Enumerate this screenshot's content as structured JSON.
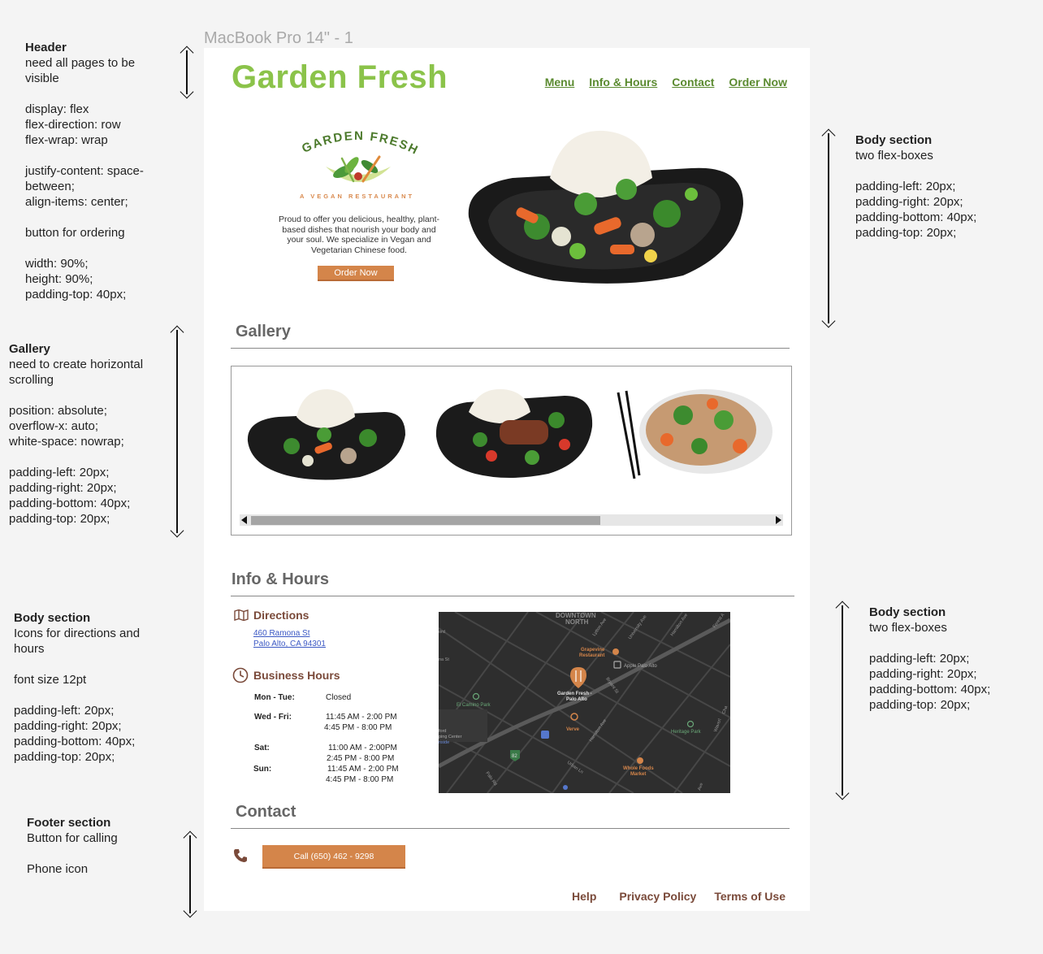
{
  "frame_label": "MacBook Pro 14\" - 1",
  "annotations": {
    "header": {
      "title": "Header",
      "lines": [
        "need all pages to be",
        "visible",
        "",
        "display: flex",
        "flex-direction: row",
        "flex-wrap: wrap",
        "",
        "justify-content: space-",
        "between;",
        "align-items: center;",
        "",
        "button for ordering",
        "",
        "width: 90%;",
        "height: 90%;",
        "padding-top: 40px;"
      ]
    },
    "gallery": {
      "title": "Gallery",
      "lines": [
        "need to create horizontal",
        "scrolling",
        "",
        "position: absolute;",
        "overflow-x: auto;",
        "white-space: nowrap;",
        "",
        "padding-left: 20px;",
        "padding-right: 20px;",
        "padding-bottom: 40px;",
        "padding-top: 20px;"
      ]
    },
    "body_info": {
      "title": "Body section",
      "lines": [
        "Icons for directions and",
        "hours",
        "",
        "font size 12pt",
        "",
        "padding-left: 20px;",
        "padding-right: 20px;",
        "padding-bottom: 40px;",
        "padding-top: 20px;"
      ]
    },
    "footer": {
      "title": "Footer section",
      "lines": [
        "Button for calling",
        "",
        "Phone icon"
      ]
    },
    "body_top_right": {
      "title": "Body section",
      "lines": [
        "two flex-boxes",
        "",
        "padding-left: 20px;",
        "padding-right: 20px;",
        "padding-bottom: 40px;",
        "padding-top: 20px;"
      ]
    },
    "body_bottom_right": {
      "title": "Body section",
      "lines": [
        "two flex-boxes",
        "",
        "padding-left: 20px;",
        "padding-right: 20px;",
        "padding-bottom: 40px;",
        "padding-top: 20px;"
      ]
    }
  },
  "site": {
    "brand": "Garden Fresh",
    "nav": [
      "Menu",
      "Info & Hours",
      "Contact",
      "Order Now"
    ],
    "logo_text": "GARDEN FRESH",
    "tagline": "A VEGAN RESTAURANT",
    "hero_text": "Proud to offer you delicious, healthy, plant-based  dishes that nourish your body and your soul. We specialize in Vegan and Vegetarian Chinese food.",
    "order_button": "Order Now"
  },
  "gallery": {
    "title": "Gallery"
  },
  "info": {
    "title": "Info & Hours",
    "directions_label": "Directions",
    "address_line1": "460 Ramona St",
    "address_line2": "Palo Alto, CA 94301",
    "hours_label": "Business Hours",
    "hours": [
      {
        "day": "Mon - Tue:",
        "times": [
          "Closed"
        ]
      },
      {
        "day": "Wed - Fri:",
        "times": [
          "11:45 AM - 2:00 PM",
          "4:45 PM - 8:00 PM"
        ]
      },
      {
        "day": "Sat:",
        "times": [
          "11:00 AM - 2:00PM",
          "2:45 PM - 8:00 PM"
        ]
      },
      {
        "day": "Sun:",
        "times": [
          "11:45 AM - 2:00 PM",
          "4:45 PM - 8:00 PM"
        ]
      }
    ],
    "map": {
      "downtown": "DOWNTOWN",
      "north": "NORTH",
      "place_main": "Garden Fresh -",
      "place_main2": "Palo Alto",
      "grapevine": "Grapevine",
      "grapevine2": "Restaurant",
      "apple": "Apple Palo Alto",
      "elcamino": "El Camino Park",
      "verve": "Verve",
      "heritage": "Heritage Park",
      "wholefoods": "Whole Foods",
      "wholefoods2": "Market",
      "stanford1": "ford",
      "stanford2": "ping Center",
      "stanford3": "nside",
      "lytton": "Lytton Ave",
      "university": "University Ave",
      "hamilton": "Hamilton Ave",
      "hamilton2": "Hamilton Ave",
      "forest": "Forest A",
      "bryant": "Bryant St",
      "urban": "Urban Ln",
      "palord": "Palo Rd",
      "waverley": "Waverl",
      "channing": "Cha",
      "ave": "Ave",
      "ord": "ord",
      "nast": "na St",
      "hwy": "82"
    }
  },
  "contact": {
    "title": "Contact",
    "call_button": "Call (650) 462 - 9298"
  },
  "footer": {
    "links": [
      "Help",
      "Privacy Policy",
      "Terms of Use"
    ]
  }
}
